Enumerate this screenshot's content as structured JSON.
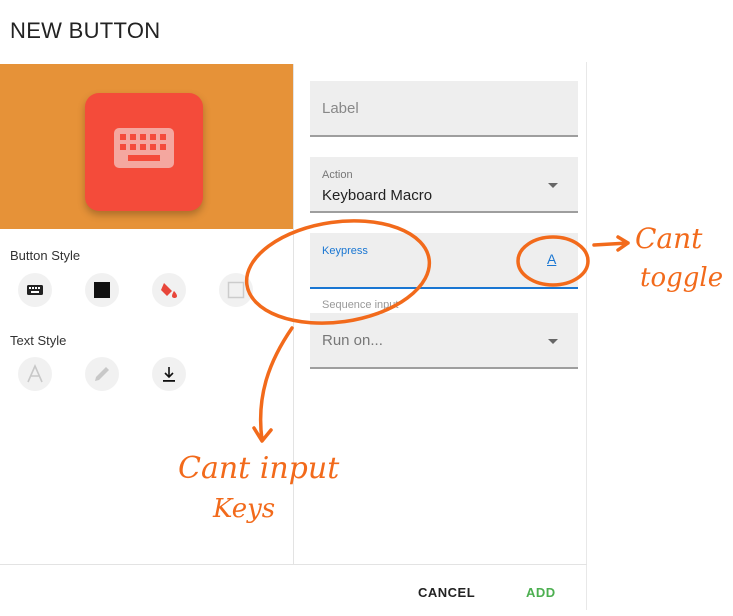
{
  "dialog": {
    "title": "NEW BUTTON"
  },
  "left_panel": {
    "preview_icon": "keyboard-icon",
    "button_style_label": "Button Style",
    "button_style_options": [
      "keyboard-icon",
      "square-icon",
      "paint-bucket-icon",
      "square-outline-icon"
    ],
    "text_style_label": "Text Style",
    "text_style_options": [
      "text-a-icon",
      "pencil-icon",
      "download-icon"
    ]
  },
  "form": {
    "label_placeholder": "Label",
    "action_label": "Action",
    "action_value": "Keyboard Macro",
    "keypress_label": "Keypress",
    "keypress_toggle": "A",
    "sequence_label": "Sequence input",
    "run_on_placeholder": "Run on..."
  },
  "footer": {
    "cancel": "CANCEL",
    "add": "ADD"
  },
  "annotations": {
    "toggle_note": "Cant toggle",
    "input_note_line1": "Cant input",
    "input_note_line2": "Keys"
  },
  "colors": {
    "preview_bg": "#e69238",
    "button_red": "#f44b3a",
    "focus_blue": "#1976d2",
    "add_green": "#4caf50",
    "annotation_orange": "#f26a1b"
  }
}
